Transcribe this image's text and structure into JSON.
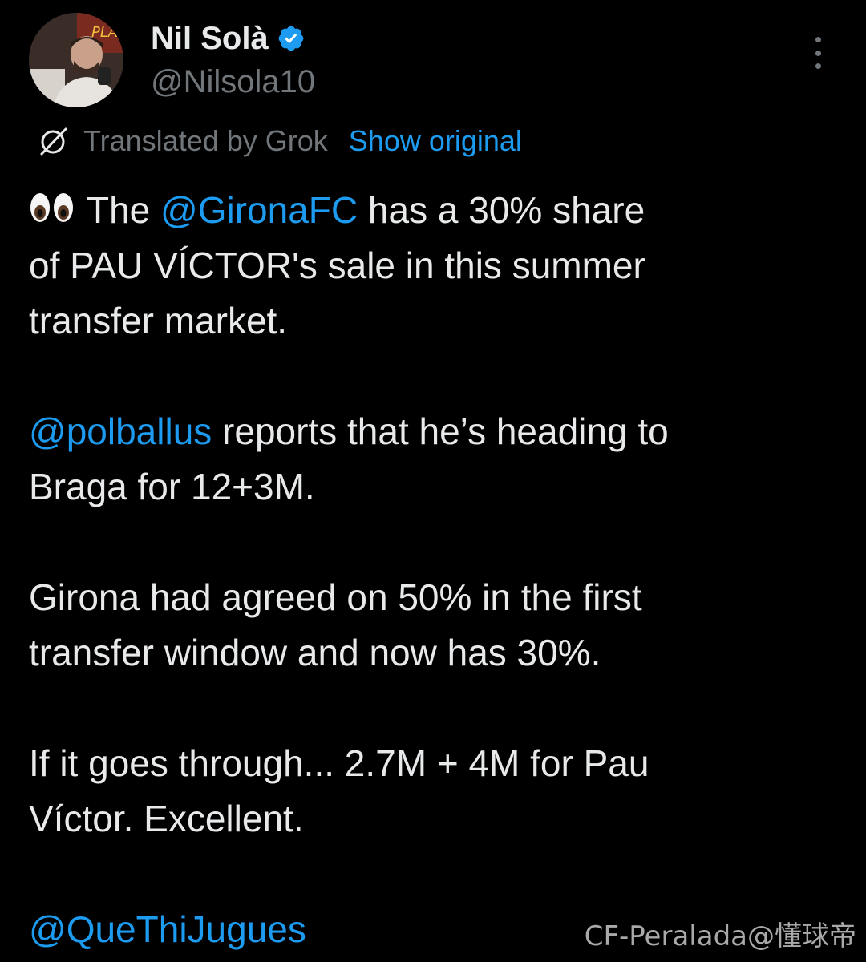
{
  "author": {
    "display_name": "Nil Solà",
    "handle": "@Nilsola10",
    "verified_color": "#1d9bf0",
    "avatar_icon": "user-avatar"
  },
  "translation": {
    "label": "Translated by Grok",
    "show_original": "Show original",
    "icon": "grok-icon"
  },
  "tweet": {
    "p1": {
      "emoji": "eyes-emoji",
      "before": "The ",
      "mention": "@GironaFC",
      "line1_after": " has a 30% share",
      "line2": "of PAU VÍCTOR's sale in this summer",
      "line3": "transfer market."
    },
    "p2": {
      "mention": "@polballus",
      "line1_after": " reports that he’s heading to",
      "line2": "Braga for 12+3M."
    },
    "p3": {
      "line1": "Girona had agreed on 50% in the first",
      "line2": "transfer window and now has 30%."
    },
    "p4": {
      "line1": "If it goes through... 2.7M + 4M for Pau",
      "line2": "Víctor. Excellent."
    },
    "p5": {
      "mention": "@QueThiJugues"
    }
  },
  "watermark": "CF-Peralada@懂球帝",
  "colors": {
    "background": "#000000",
    "text": "#e7e9ea",
    "secondary": "#71767b",
    "link": "#1d9bf0"
  }
}
